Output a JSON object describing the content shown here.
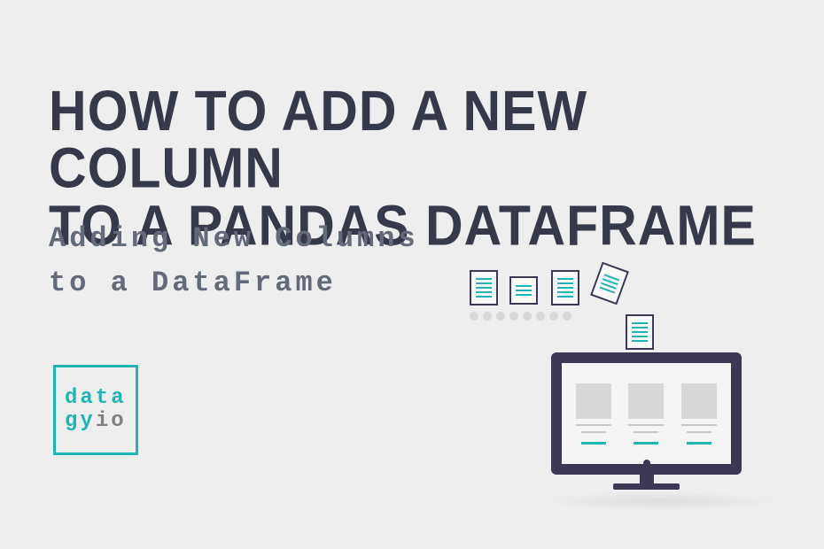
{
  "title_line1": "HOW TO ADD A NEW COLUMN",
  "title_line2": "TO A PANDAS DATAFRAME",
  "subtitle_line1": "Adding New Columns",
  "subtitle_line2": "to a DataFrame",
  "logo": {
    "line1": "data",
    "line2a": "gy",
    "line2b": "io"
  },
  "colors": {
    "accent": "#1fb5b5",
    "dark": "#36394a",
    "illustration_dark": "#3a3853",
    "subtitle": "#636b7a",
    "background": "#eeeeee"
  }
}
